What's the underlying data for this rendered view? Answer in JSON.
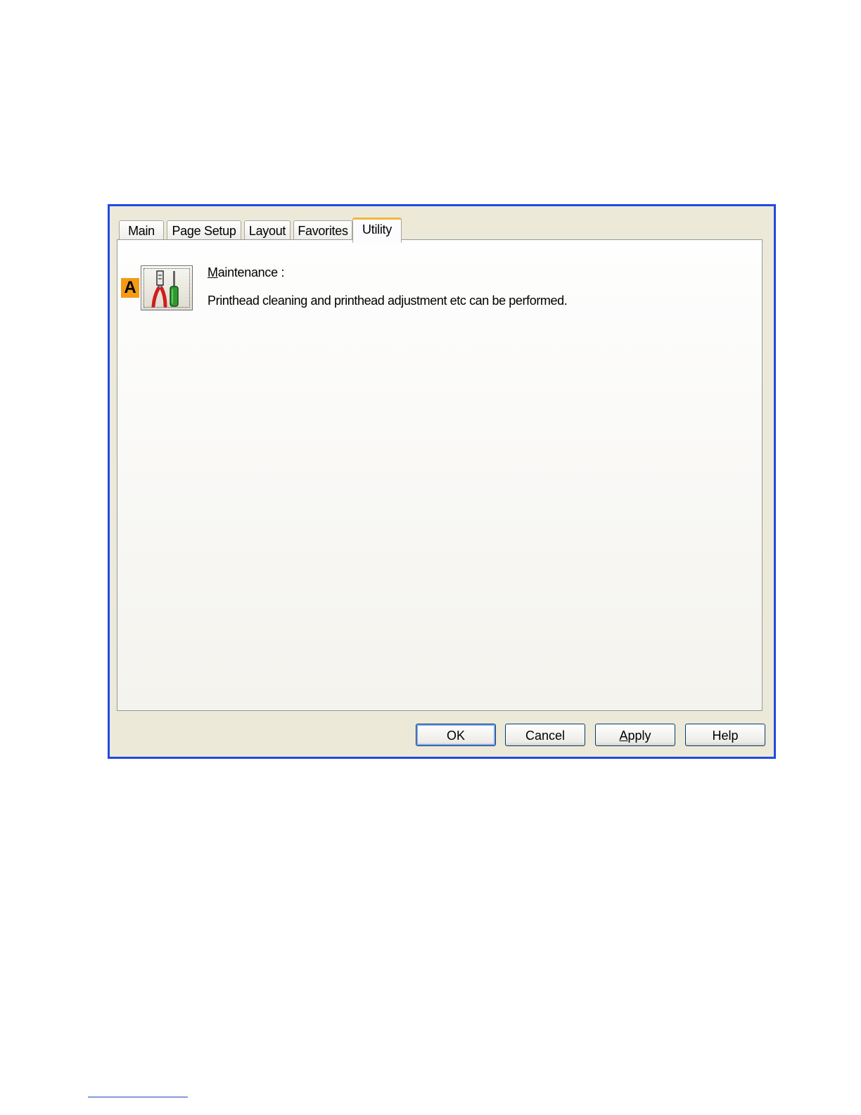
{
  "tabs": [
    {
      "label": "Main",
      "active": false
    },
    {
      "label": "Page Setup",
      "active": false
    },
    {
      "label": "Layout",
      "active": false
    },
    {
      "label": "Favorites",
      "active": false
    },
    {
      "label": "Utility",
      "active": true
    }
  ],
  "utility": {
    "marker_label": "A",
    "maintenance_icon": "tools-icon",
    "maintenance_title_accel": "M",
    "maintenance_title_rest": "aintenance :",
    "maintenance_desc": "Printhead cleaning and printhead adjustment etc can be performed."
  },
  "buttons": {
    "ok": "OK",
    "cancel": "Cancel",
    "apply_accel": "A",
    "apply_rest": "pply",
    "help": "Help"
  },
  "colors": {
    "window_border": "#1f4be3",
    "active_tab_accent": "#f5b63a",
    "marker": "#f39a16"
  }
}
